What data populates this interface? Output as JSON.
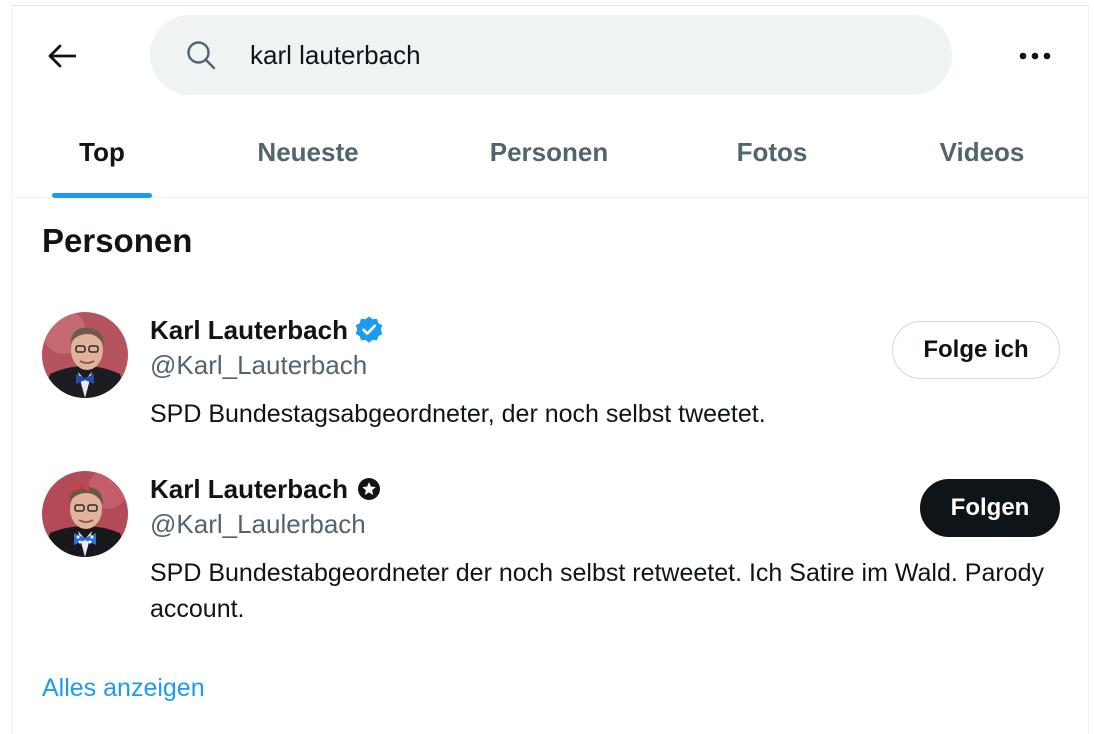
{
  "search": {
    "query": "karl lauterbach",
    "back_icon": "arrow-left-icon",
    "search_icon": "magnifier-icon",
    "more_icon": "more-horizontal-icon"
  },
  "tabs": [
    {
      "label": "Top",
      "active": true
    },
    {
      "label": "Neueste",
      "active": false
    },
    {
      "label": "Personen",
      "active": false
    },
    {
      "label": "Fotos",
      "active": false
    },
    {
      "label": "Videos",
      "active": false
    }
  ],
  "section": {
    "title": "Personen"
  },
  "users": [
    {
      "name": "Karl Lauterbach",
      "handle": "@Karl_Lauterbach",
      "bio": "SPD Bundestagsabgeordneter, der noch selbst tweetet.",
      "badge": "verified-badge-icon",
      "follow_label": "Folge ich",
      "following": true
    },
    {
      "name": "Karl Lauterbach",
      "handle": "@Karl_Laulerbach",
      "bio": "SPD Bundestabgeordneter der noch selbst retweetet. Ich Satire im Wald. Parody account.",
      "badge": "star-badge-icon",
      "follow_label": "Folgen",
      "following": false
    }
  ],
  "footer": {
    "show_all": "Alles anzeigen"
  },
  "colors": {
    "accent": "#1d9bf0",
    "text_primary": "#0f1419",
    "text_secondary": "#536471",
    "search_bg": "#eff3f4"
  }
}
